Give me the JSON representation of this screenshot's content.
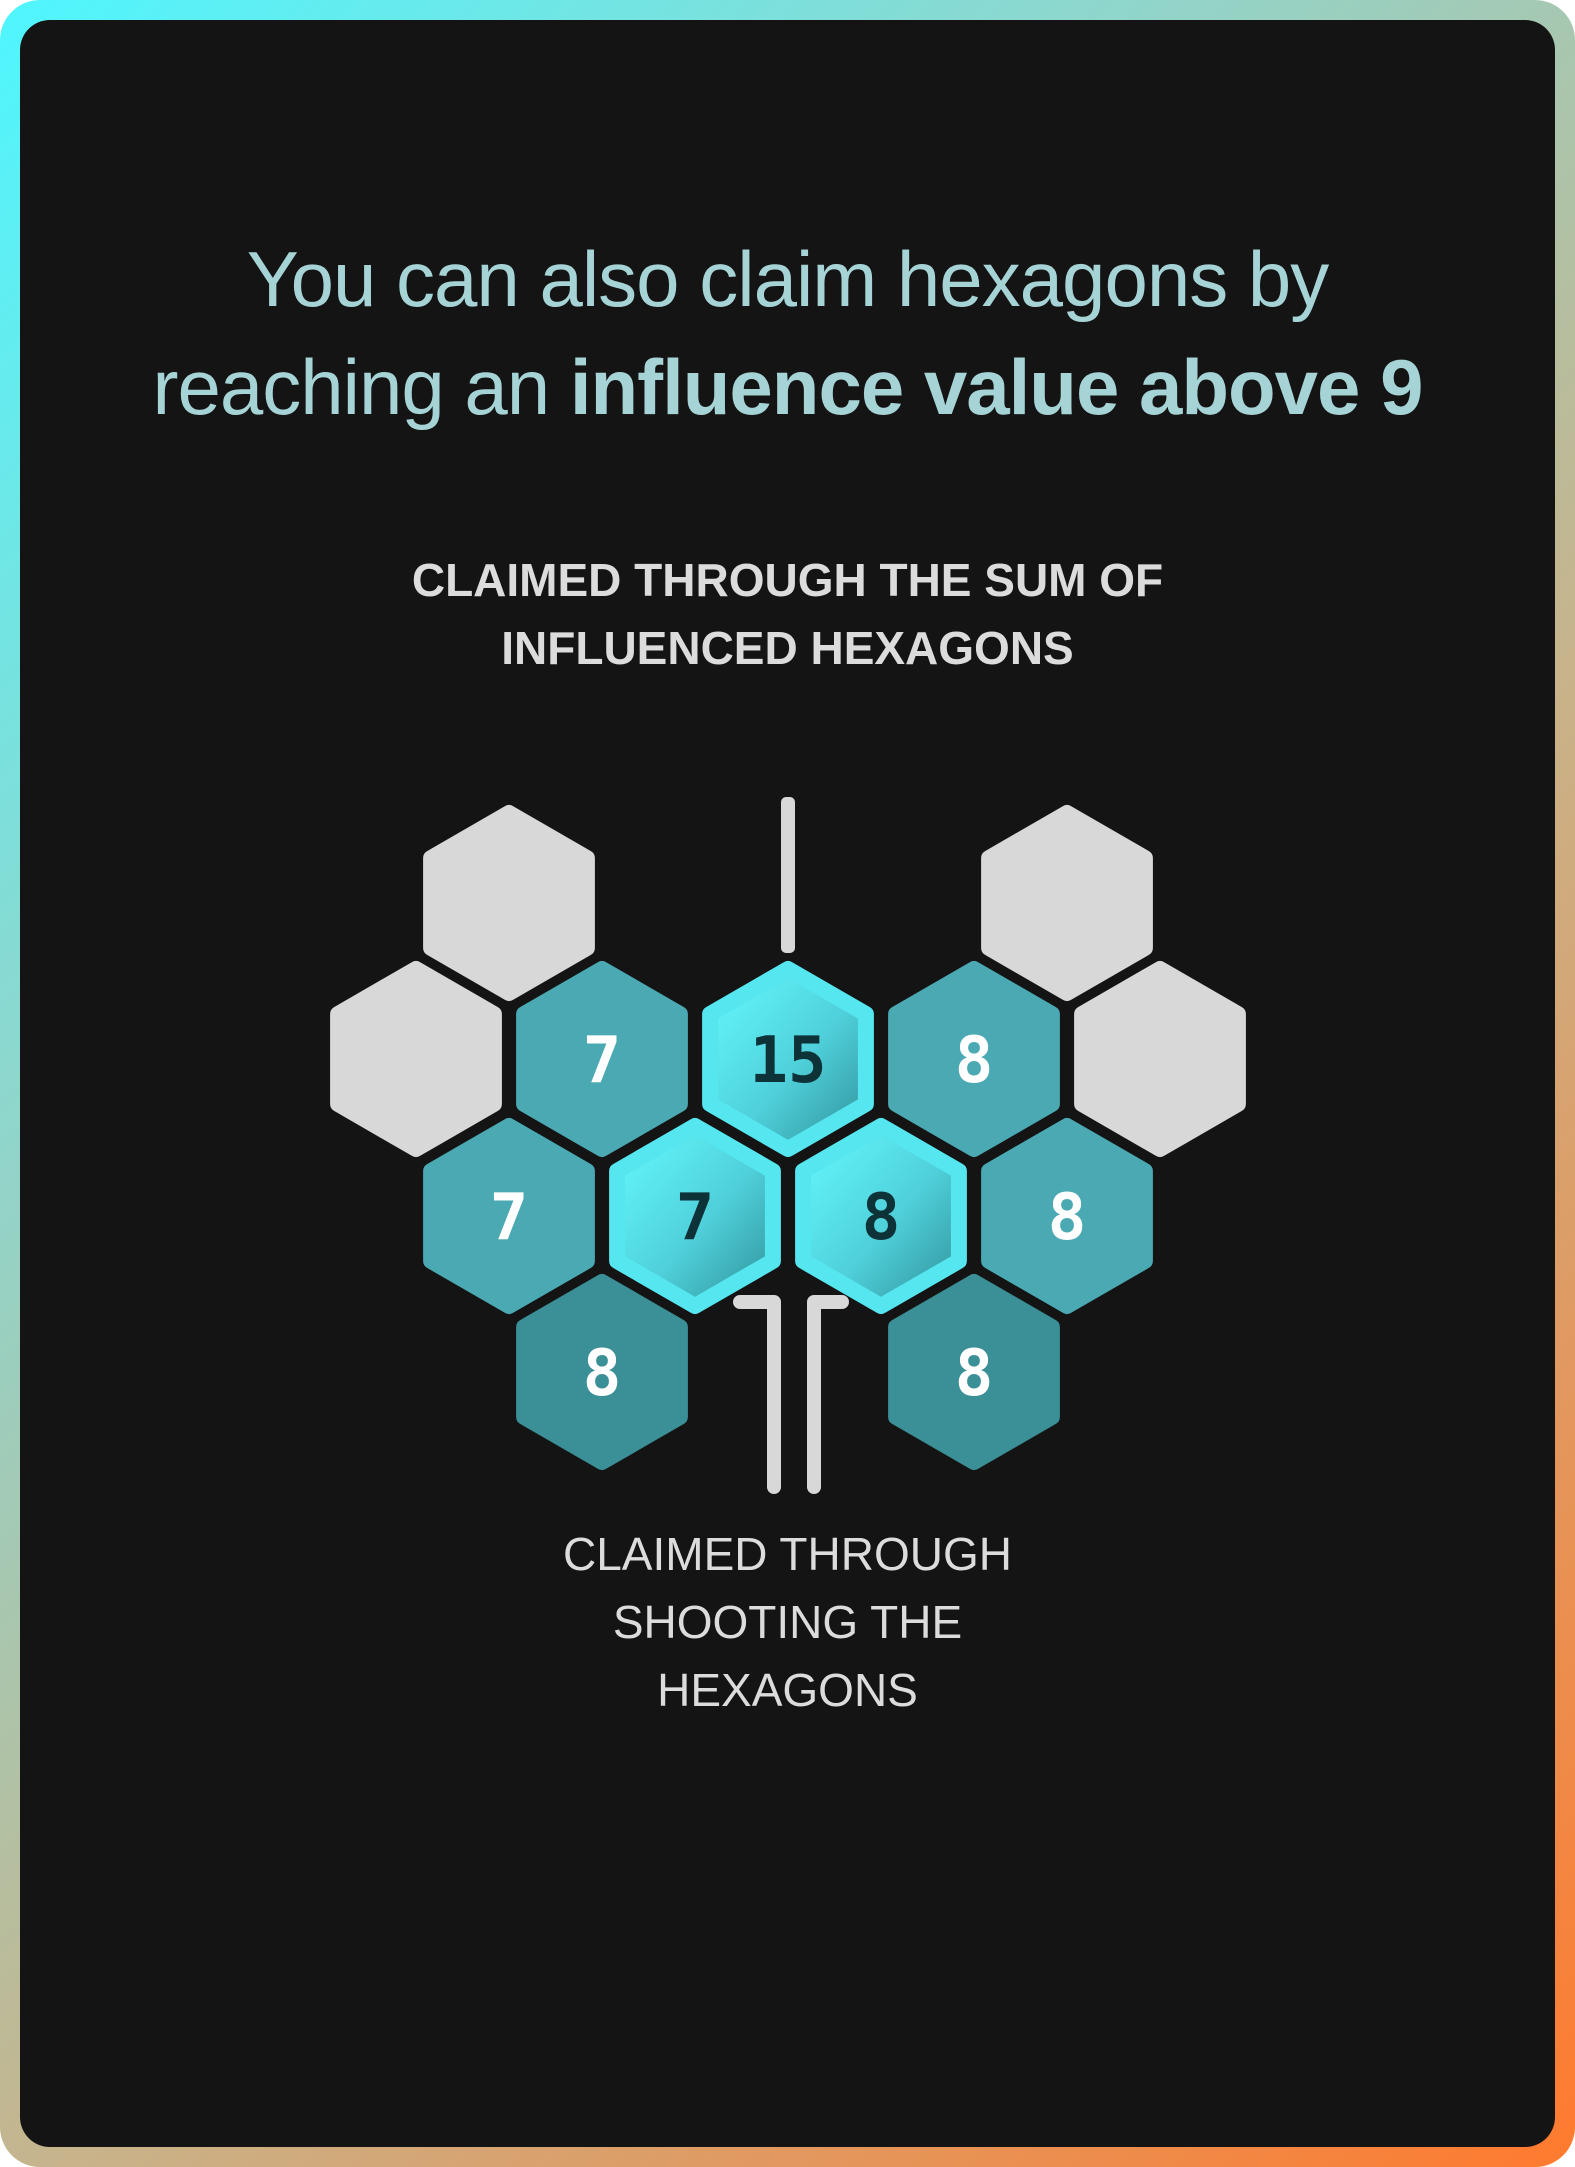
{
  "headline": {
    "line1": "You can also claim hexagons by",
    "line2_normal": "reaching an",
    "line2_bold": "influence value above 9"
  },
  "caption_sum": {
    "line1": "CLAIMED THROUGH THE SUM OF",
    "line2": "INFLUENCED HEXAGONS"
  },
  "caption_shooting": {
    "line1": "CLAIMED THROUGH",
    "line2": "SHOOTING THE",
    "line3": "HEXAGONS"
  },
  "colors": {
    "background": "#141414",
    "border_gradient": [
      "#4ff6ff",
      "#ff7a2e"
    ],
    "hex_empty": "#d8d8d8",
    "hex_influence": "#4aa9b2",
    "hex_influence_dark": "#3a9096",
    "hex_claimed": "#5ff4ff",
    "headline": "#a6d3d6",
    "caption": "#dcdcdc"
  },
  "hexagons": [
    {
      "id": "top-left",
      "state": "empty",
      "value": ""
    },
    {
      "id": "top-right",
      "state": "empty",
      "value": ""
    },
    {
      "id": "mid-left",
      "state": "empty",
      "value": ""
    },
    {
      "id": "mid-2",
      "state": "influence",
      "value": "7"
    },
    {
      "id": "mid-center",
      "state": "claimed-sum",
      "value": "15"
    },
    {
      "id": "mid-4",
      "state": "influence",
      "value": "8"
    },
    {
      "id": "mid-right",
      "state": "empty",
      "value": ""
    },
    {
      "id": "row3-1",
      "state": "influence",
      "value": "7"
    },
    {
      "id": "row3-2",
      "state": "claimed-shot",
      "value": "7"
    },
    {
      "id": "row3-3",
      "state": "claimed-shot",
      "value": "8"
    },
    {
      "id": "row3-4",
      "state": "influence",
      "value": "8"
    },
    {
      "id": "bottom-left",
      "state": "influence-dark",
      "value": "8"
    },
    {
      "id": "bottom-right",
      "state": "influence-dark",
      "value": "8"
    }
  ]
}
